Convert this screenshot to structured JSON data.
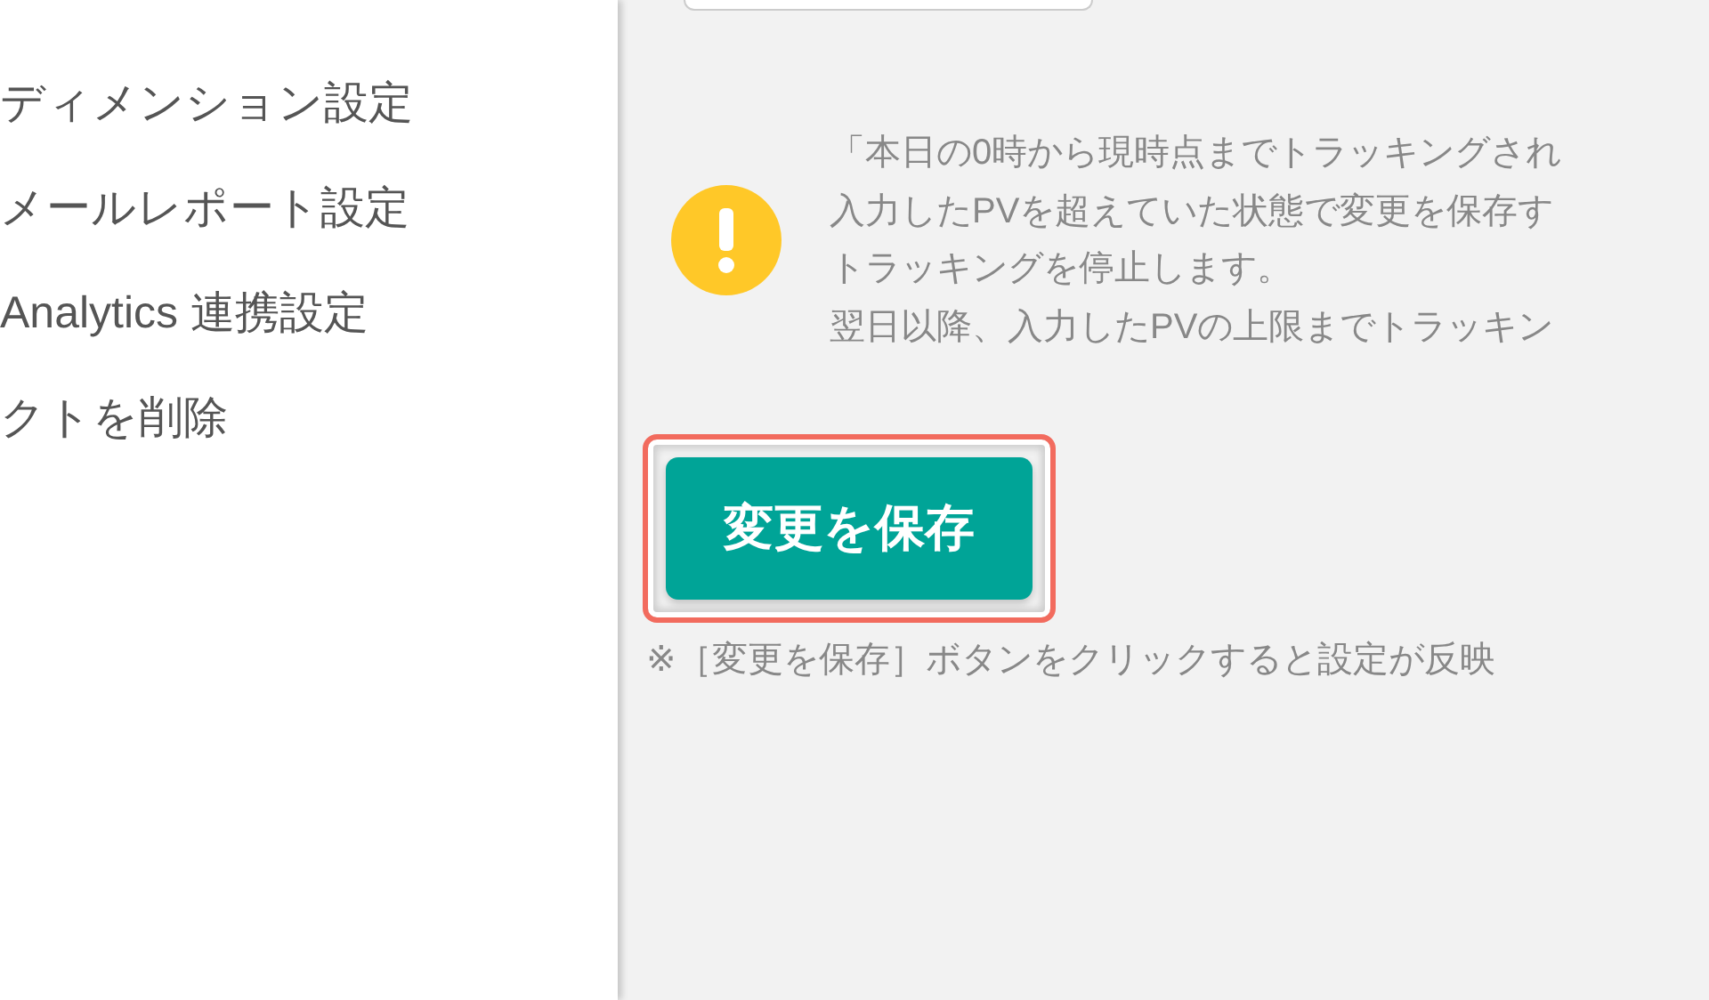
{
  "sidebar": {
    "items": [
      {
        "label": "ディメンション設定"
      },
      {
        "label": "メールレポート設定"
      },
      {
        "label": "Analytics 連携設定"
      },
      {
        "label": "クトを削除"
      }
    ]
  },
  "notice": {
    "lines": [
      "「本日の0時から現時点までトラッキングされ",
      "入力したPVを超えていた状態で変更を保存す",
      "トラッキングを停止します。",
      "翌日以降、入力したPVの上限までトラッキン"
    ]
  },
  "save_button": {
    "label": "変更を保存",
    "highlighted": true
  },
  "footnote": "※［変更を保存］ボタンをクリックすると設定が反映"
}
